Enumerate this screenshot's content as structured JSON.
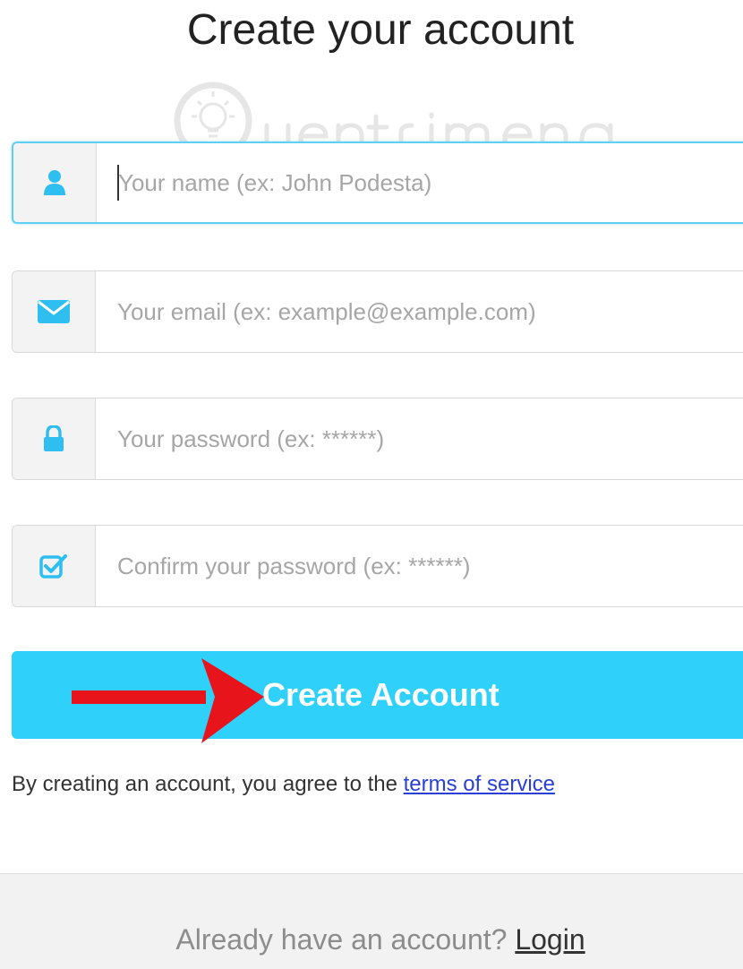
{
  "header": {
    "title": "Create your account"
  },
  "form": {
    "name": {
      "placeholder": "Your name (ex: John Podesta)",
      "icon": "user-icon"
    },
    "email": {
      "placeholder": "Your email (ex: example@example.com)",
      "icon": "envelope-icon"
    },
    "password": {
      "placeholder": "Your password (ex: ******)",
      "icon": "lock-icon"
    },
    "confirm": {
      "placeholder": "Confirm your password (ex: ******)",
      "icon": "checkbox-icon"
    },
    "submit_label": "Create Account",
    "terms_prefix": "By creating an account, you agree to the ",
    "terms_link": "terms of service"
  },
  "footer": {
    "prompt": "Already have an account? ",
    "login_link": "Login"
  },
  "colors": {
    "accent": "#2fd0fa",
    "icon": "#2fbef0",
    "focus_border": "#5fd0f3",
    "link": "#2a3fd6",
    "arrow": "#e8141c"
  }
}
